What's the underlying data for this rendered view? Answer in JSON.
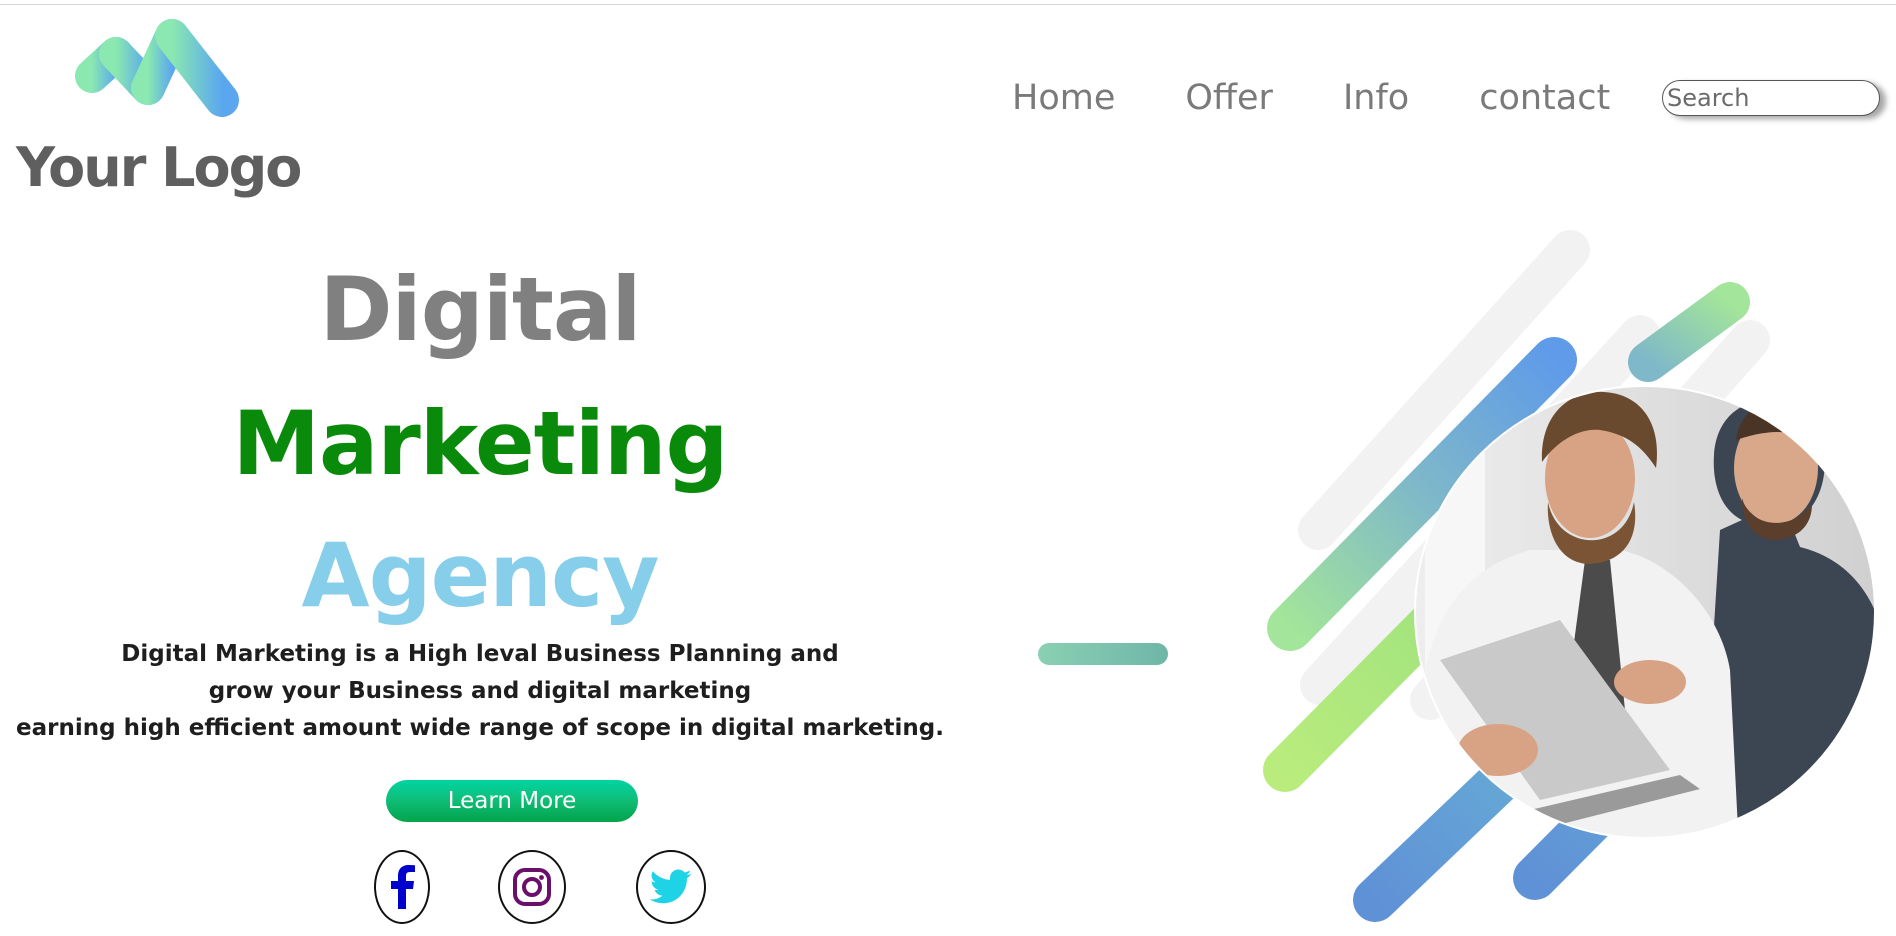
{
  "header": {
    "logo_text": "Your Logo",
    "nav": [
      {
        "label": "Home"
      },
      {
        "label": "Offer"
      },
      {
        "label": "Info"
      },
      {
        "label": "contact"
      }
    ],
    "search": {
      "placeholder": "Search",
      "value": ""
    }
  },
  "hero": {
    "title_line1": "Digital",
    "title_line2": "Marketing",
    "title_line3": "Agency",
    "description": [
      "Digital Marketing is a High leval Business Planning and",
      "grow your Business and digital marketing",
      "earning high efficient amount wide range of scope in digital marketing."
    ],
    "cta_label": "Learn More"
  },
  "social": [
    {
      "icon": "facebook-icon",
      "color": "#0000cc"
    },
    {
      "icon": "instagram-icon",
      "color": "#6a0f6a"
    },
    {
      "icon": "twitter-icon",
      "color": "#1ed3e6"
    }
  ],
  "colors": {
    "title_gray": "#808080",
    "title_green": "#0a8a0a",
    "title_blue": "#87ceeb",
    "cta_gradient_top": "#00d4a2",
    "cta_gradient_bottom": "#03a34a",
    "nav_text": "#7a7a7a"
  }
}
